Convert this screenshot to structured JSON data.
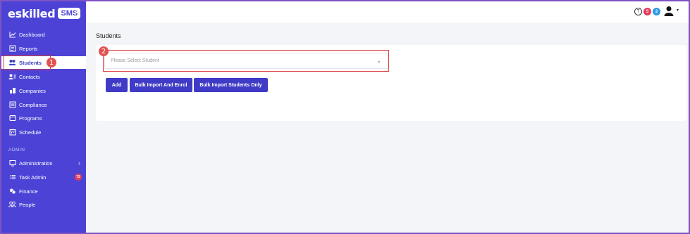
{
  "brand": {
    "name": "eskilled",
    "badge": "SMS"
  },
  "sidebar": {
    "collapse_icon": "«",
    "items": [
      {
        "label": "Dashboard",
        "icon": "chart-line-icon"
      },
      {
        "label": "Reports",
        "icon": "report-icon"
      },
      {
        "label": "Students",
        "icon": "users-icon",
        "active": true
      },
      {
        "label": "Contacts",
        "icon": "contact-card-icon"
      },
      {
        "label": "Companies",
        "icon": "building-icon"
      },
      {
        "label": "Compliance",
        "icon": "checklist-icon"
      },
      {
        "label": "Programs",
        "icon": "program-icon"
      },
      {
        "label": "Schedule",
        "icon": "calendar-icon"
      }
    ],
    "admin_label": "ADMIN",
    "admin_items": [
      {
        "label": "Administration",
        "icon": "monitor-icon"
      },
      {
        "label": "Task Admin",
        "icon": "list-icon",
        "badge": "72"
      },
      {
        "label": "Finance",
        "icon": "coins-icon"
      },
      {
        "label": "People",
        "icon": "people-icon"
      }
    ]
  },
  "topbar": {
    "help": "?",
    "badge_red": "5",
    "badge_blue": "2",
    "caret": "▾"
  },
  "main": {
    "title": "Students",
    "select_placeholder": "Please Select Student",
    "buttons": {
      "add": "Add",
      "bulk_enrol": "Bulk Import And Enrol",
      "bulk_only": "Bulk Import Students Only"
    }
  },
  "annotations": {
    "step1": "1",
    "step2": "2"
  },
  "colors": {
    "sidebar": "#4c43d6",
    "button": "#3f3bc6",
    "annotation": "#e03a3a"
  }
}
